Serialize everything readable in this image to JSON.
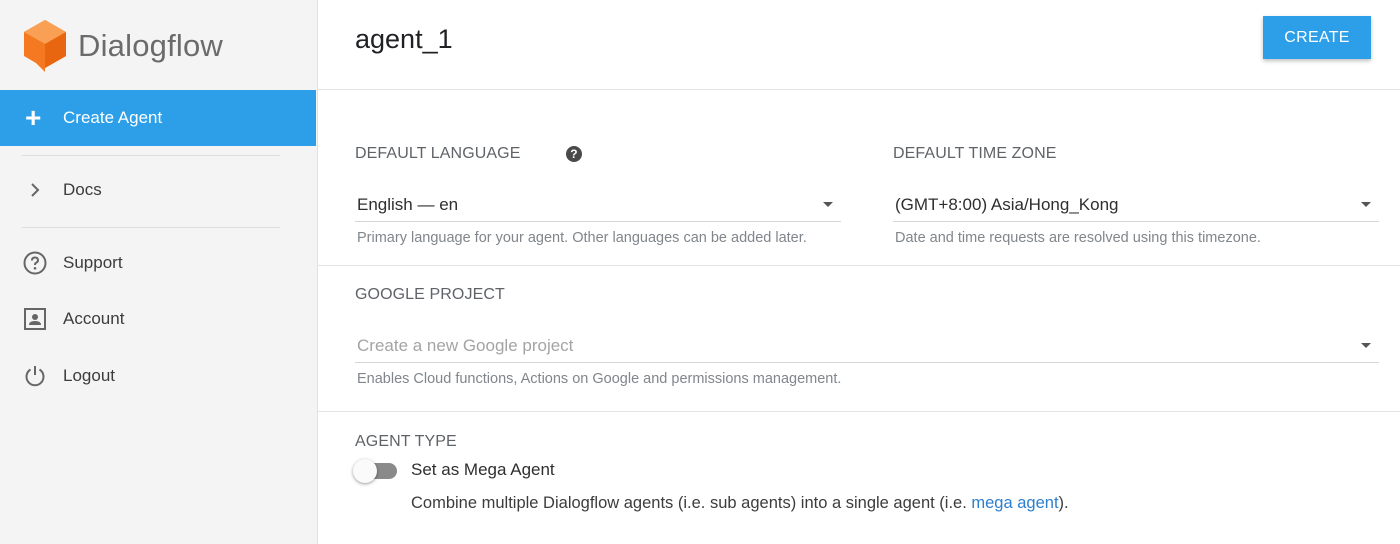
{
  "app": {
    "name": "Dialogflow",
    "logo_color": "#f47920"
  },
  "sidebar": {
    "create_label": "Create Agent",
    "items": [
      {
        "label": "Docs",
        "icon": "chevron-right-icon"
      },
      {
        "label": "Support",
        "icon": "help-circle-icon"
      },
      {
        "label": "Account",
        "icon": "account-box-icon"
      },
      {
        "label": "Logout",
        "icon": "power-icon"
      }
    ]
  },
  "header": {
    "agent_name": "agent_1",
    "create_button": "CREATE"
  },
  "form": {
    "language": {
      "label": "DEFAULT LANGUAGE",
      "value": "English — en",
      "hint": "Primary language for your agent. Other languages can be added later."
    },
    "timezone": {
      "label": "DEFAULT TIME ZONE",
      "value": "(GMT+8:00) Asia/Hong_Kong",
      "hint": "Date and time requests are resolved using this timezone."
    },
    "google_project": {
      "label": "GOOGLE PROJECT",
      "placeholder": "Create a new Google project",
      "hint": "Enables Cloud functions, Actions on Google and permissions management."
    },
    "agent_type": {
      "label": "AGENT TYPE",
      "toggle_label": "Set as Mega Agent",
      "toggle_on": false,
      "desc_before": "Combine multiple Dialogflow agents (i.e. sub agents) into a single agent (i.e. ",
      "desc_link": "mega agent",
      "desc_after": ")."
    }
  },
  "colors": {
    "accent": "#2c9fe8",
    "link": "#2c7ecf"
  }
}
